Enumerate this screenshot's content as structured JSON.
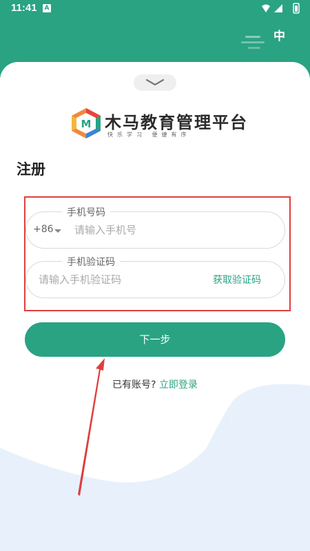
{
  "status_bar": {
    "time": "11:41",
    "notification_glyph": "A"
  },
  "language_toggle": "中",
  "brand": {
    "logo_letter": "M",
    "name": "木马教育管理平台",
    "slogan": "快乐学习 便捷有序"
  },
  "page_title": "注册",
  "phone_field": {
    "label": "手机号码",
    "country_code": "+86",
    "placeholder": "请输入手机号",
    "value": ""
  },
  "code_field": {
    "label": "手机验证码",
    "placeholder": "请输入手机验证码",
    "value": "",
    "get_code_label": "获取验证码"
  },
  "next_button_label": "下一步",
  "login_prompt": {
    "prefix": "已有账号?",
    "link": "立即登录"
  },
  "colors": {
    "accent": "#2aa382",
    "annotation_red": "#e03e3e",
    "background_blob": "#e8f1fb"
  }
}
